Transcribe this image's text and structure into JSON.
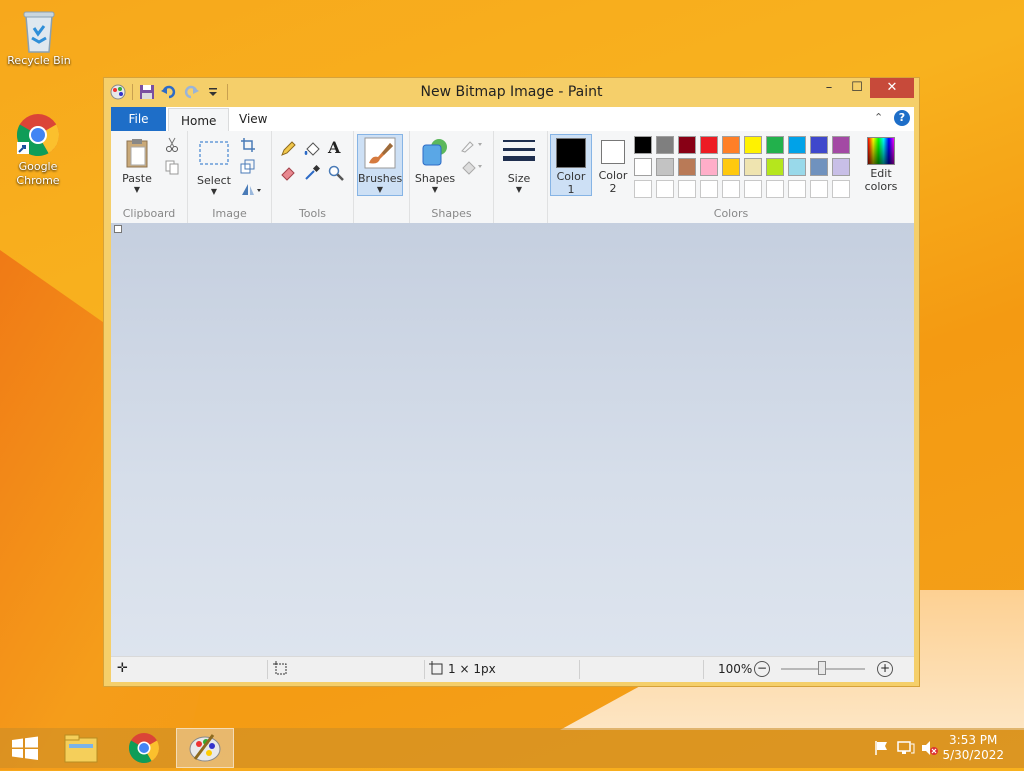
{
  "desktop": {
    "icons": [
      {
        "label": "Recycle Bin"
      },
      {
        "label": "Google Chrome"
      }
    ]
  },
  "window": {
    "title": "New Bitmap Image - Paint",
    "controls": {
      "minimize": "–",
      "maximize": "☐",
      "close": "✕"
    }
  },
  "menu": {
    "file": "File",
    "tabs": [
      "Home",
      "View"
    ],
    "active_tab": "Home"
  },
  "ribbon": {
    "clipboard": {
      "paste": "Paste",
      "label": "Clipboard"
    },
    "image": {
      "select": "Select",
      "label": "Image"
    },
    "tools": {
      "label": "Tools"
    },
    "brushes": {
      "label": "Brushes"
    },
    "shapes": {
      "shapes": "Shapes",
      "label": "Shapes"
    },
    "size": {
      "label": "Size"
    },
    "colors": {
      "color1": [
        "Color",
        "1"
      ],
      "color2": [
        "Color",
        "2"
      ],
      "edit": [
        "Edit",
        "colors"
      ],
      "label": "Colors",
      "color1_value": "#000000",
      "color2_value": "#ffffff",
      "palette_row1": [
        "#000000",
        "#7f7f7f",
        "#880015",
        "#ed1c24",
        "#ff7f27",
        "#fff200",
        "#22b14c",
        "#00a2e8",
        "#3f48cc",
        "#a349a4"
      ],
      "palette_row2": [
        "#ffffff",
        "#c3c3c3",
        "#b97a57",
        "#ffaec9",
        "#ffc90e",
        "#efe4b0",
        "#b5e61d",
        "#99d9ea",
        "#7092be",
        "#c8bfe7"
      ],
      "palette_row3": [
        "#ffffff",
        "#ffffff",
        "#ffffff",
        "#ffffff",
        "#ffffff",
        "#ffffff",
        "#ffffff",
        "#ffffff",
        "#ffffff",
        "#ffffff"
      ]
    }
  },
  "status": {
    "size": "1 × 1px",
    "zoom": "100%"
  },
  "taskbar": {
    "time": "3:53 PM",
    "date": "5/30/2022"
  }
}
